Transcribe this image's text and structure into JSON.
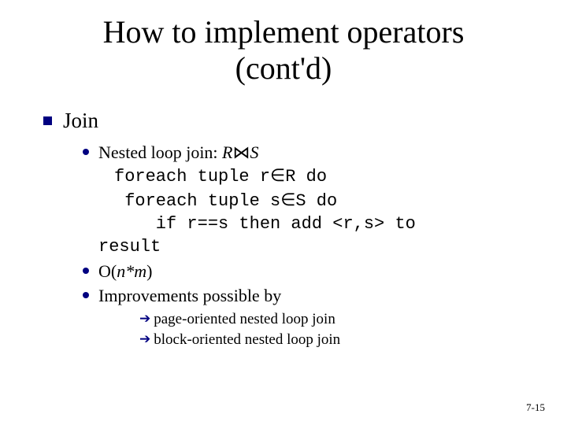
{
  "title_line1": "How to implement operators",
  "title_line2": "(cont'd)",
  "section": "Join",
  "bullets": {
    "b1_prefix": "Nested loop join: ",
    "b1_R": "R",
    "b1_join": "⋈",
    "b1_S": "S",
    "code_l1a": "foreach tuple r",
    "code_l1b": "R do",
    "code_l2a": " foreach tuple s",
    "code_l2b": "S do",
    "code_l3": "    if r==s then add <r,s> to",
    "code_l4": "result",
    "elem": "∈",
    "b2_pre": "O(",
    "b2_nm": "n*m",
    "b2_post": ")",
    "b3": "Improvements possible by"
  },
  "sub": {
    "s1": "page-oriented nested loop join",
    "s2": "block-oriented nested loop join",
    "arrow": "➔"
  },
  "footer": "7-15"
}
